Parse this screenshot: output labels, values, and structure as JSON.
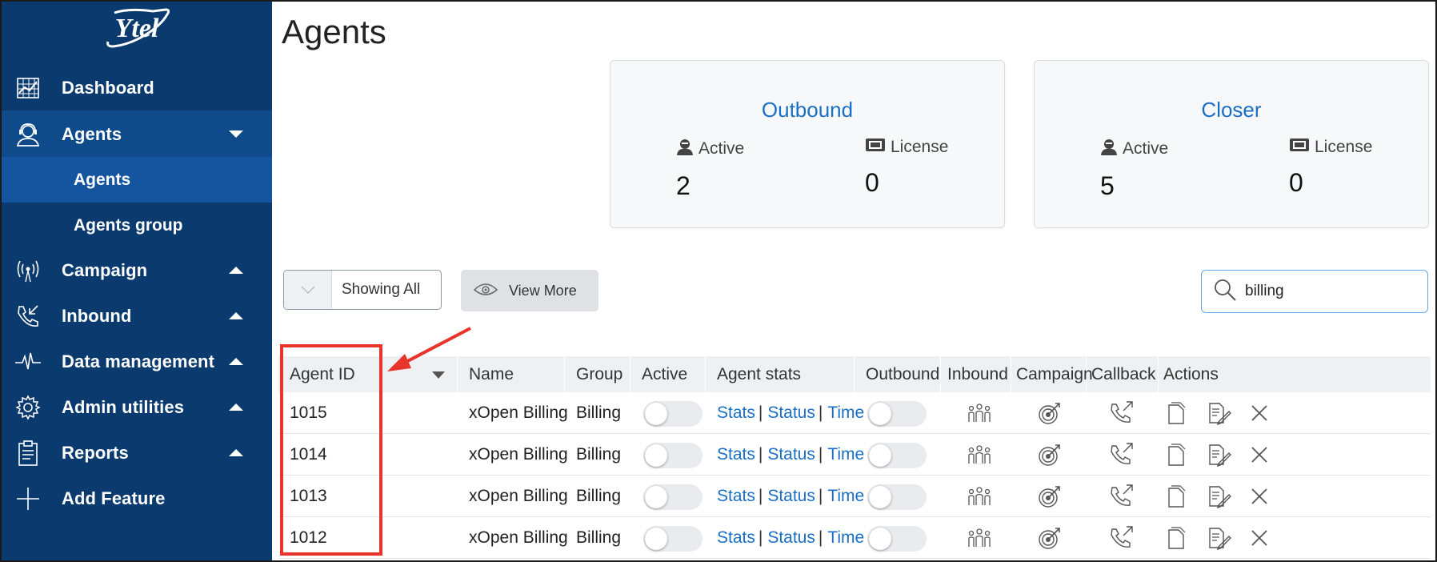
{
  "brand": {
    "logo_text": "Ytel"
  },
  "sidebar": {
    "items": [
      {
        "label": "Dashboard",
        "icon": "dashboard-icon",
        "caret": ""
      },
      {
        "label": "Agents",
        "icon": "agent-headset-icon",
        "caret": "down"
      },
      {
        "label": "Campaign",
        "icon": "broadcast-icon",
        "caret": "up"
      },
      {
        "label": "Inbound",
        "icon": "inbound-call-icon",
        "caret": "up"
      },
      {
        "label": "Data management",
        "icon": "pulse-icon",
        "caret": "up"
      },
      {
        "label": "Admin utilities",
        "icon": "gear-icon",
        "caret": "up"
      },
      {
        "label": "Reports",
        "icon": "clipboard-icon",
        "caret": "up"
      },
      {
        "label": "Add Feature",
        "icon": "plus-icon",
        "caret": ""
      }
    ],
    "subitems": [
      {
        "label": "Agents"
      },
      {
        "label": "Agents group"
      }
    ]
  },
  "page": {
    "title": "Agents"
  },
  "cards": [
    {
      "title": "Outbound",
      "active_label": "Active",
      "active_value": "2",
      "license_label": "License",
      "license_value": "0"
    },
    {
      "title": "Closer",
      "active_label": "Active",
      "active_value": "5",
      "license_label": "License",
      "license_value": "0"
    }
  ],
  "toolbar": {
    "showing_label": "Showing All",
    "view_more_label": "View More"
  },
  "search": {
    "value": "billing"
  },
  "table": {
    "columns": [
      "Agent ID",
      "Name",
      "Group",
      "Active",
      "Agent stats",
      "Outbound",
      "Inbound",
      "Campaign",
      "Callback",
      "Actions"
    ],
    "stats_links": [
      "Stats",
      "Status",
      "Time"
    ],
    "separator": "|",
    "rows": [
      {
        "agent_id": "1015",
        "name": "xOpen Billing",
        "group": "Billing",
        "active": false,
        "outbound": false
      },
      {
        "agent_id": "1014",
        "name": "xOpen Billing",
        "group": "Billing",
        "active": false,
        "outbound": false
      },
      {
        "agent_id": "1013",
        "name": "xOpen Billing",
        "group": "Billing",
        "active": false,
        "outbound": false
      },
      {
        "agent_id": "1012",
        "name": "xOpen Billing",
        "group": "Billing",
        "active": false,
        "outbound": false
      }
    ]
  },
  "colors": {
    "sidebar_bg": "#0a3a6e",
    "sidebar_active": "#1555a0",
    "link": "#1a6fc4",
    "annotation": "#e8342a"
  }
}
